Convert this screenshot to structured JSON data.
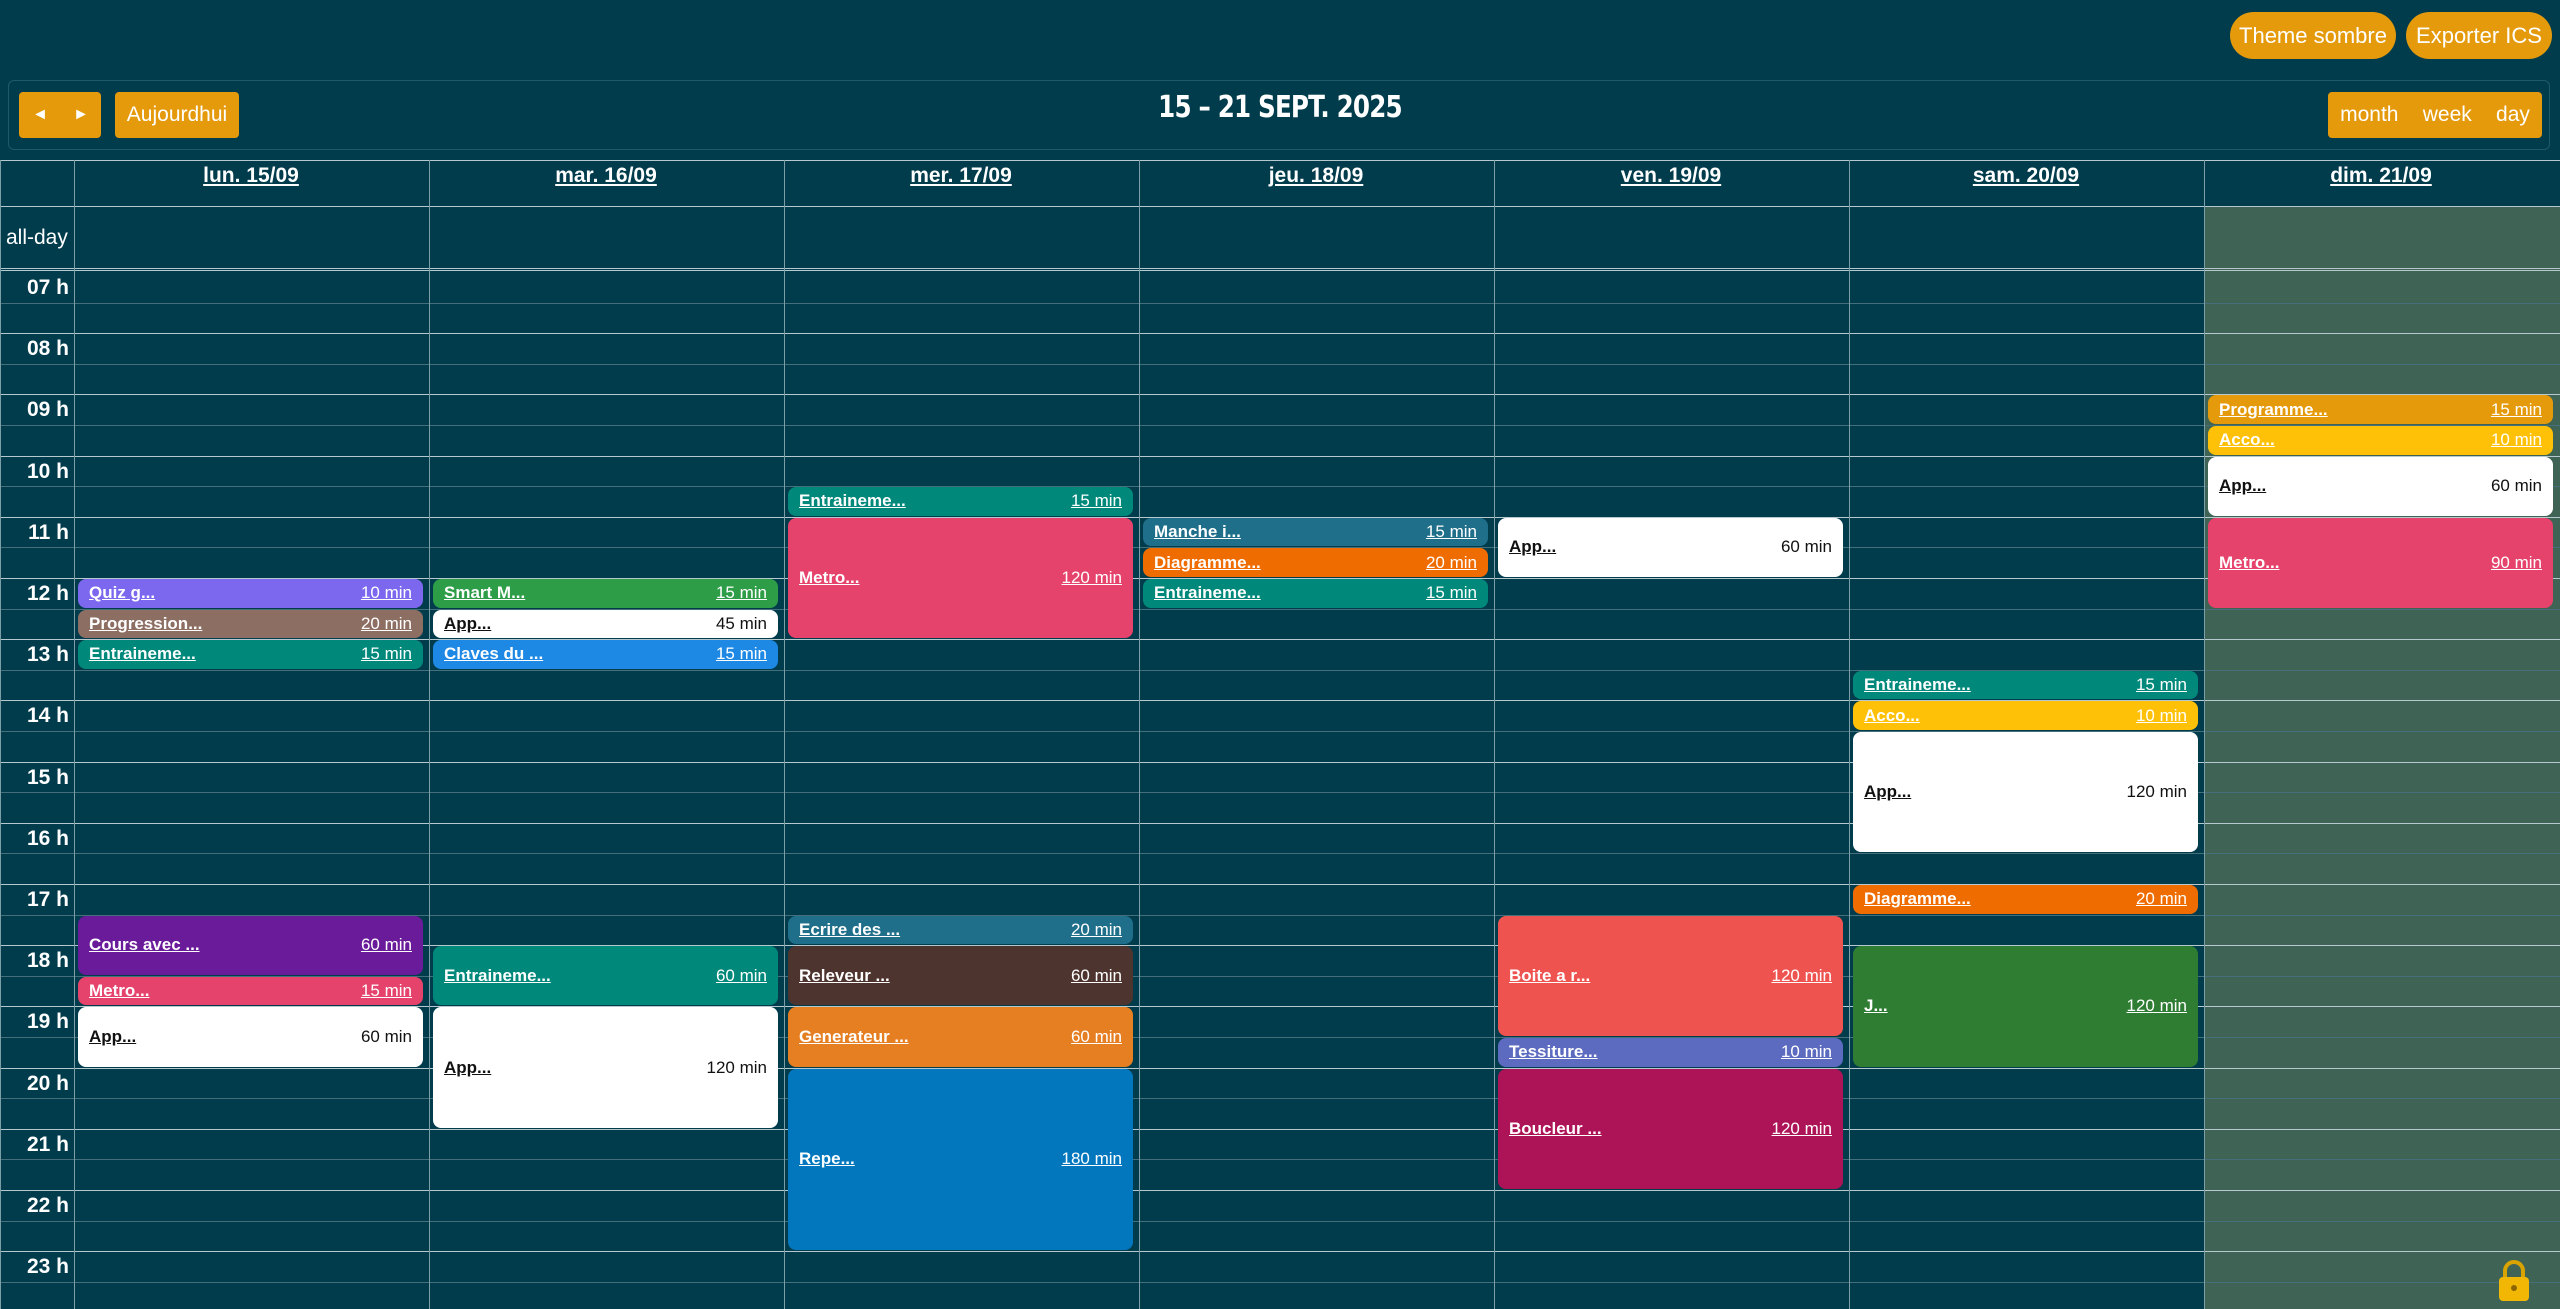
{
  "top_buttons": {
    "theme": "Theme sombre",
    "export": "Exporter ICS"
  },
  "toolbar": {
    "prev_icon": "◄",
    "next_icon": "►",
    "today": "Aujourdhui",
    "title": "15 – 21 SEPT. 2025",
    "views": [
      "month",
      "week",
      "day"
    ]
  },
  "days": [
    "lun. 15/09",
    "mar. 16/09",
    "mer. 17/09",
    "jeu. 18/09",
    "ven. 19/09",
    "sam. 20/09",
    "dim. 21/09"
  ],
  "allday_label": "all-day",
  "hours": [
    "07 h",
    "08 h",
    "09 h",
    "10 h",
    "11 h",
    "12 h",
    "13 h",
    "14 h",
    "15 h",
    "16 h",
    "17 h",
    "18 h",
    "19 h",
    "20 h",
    "21 h",
    "22 h",
    "23 h"
  ],
  "colors": {
    "background": "#003c4c",
    "accent": "#e59a0c",
    "sunday_highlight": "#3f6355"
  },
  "events": [
    {
      "day": 0,
      "start": "12:00",
      "minutes": 30,
      "title": "Quiz g...",
      "duration": "10 min",
      "color": "#7b68ee"
    },
    {
      "day": 0,
      "start": "12:30",
      "minutes": 30,
      "title": "Progression...",
      "duration": "20 min",
      "color": "#8d6e63"
    },
    {
      "day": 0,
      "start": "13:00",
      "minutes": 30,
      "title": "Entraineme...",
      "duration": "15 min",
      "color": "#00897b"
    },
    {
      "day": 0,
      "start": "17:30",
      "minutes": 60,
      "title": "Cours avec ...",
      "duration": "60 min",
      "color": "#6a1b9a"
    },
    {
      "day": 0,
      "start": "18:30",
      "minutes": 30,
      "title": "Metro...",
      "duration": "15 min",
      "color": "#e5436b"
    },
    {
      "day": 0,
      "start": "19:00",
      "minutes": 60,
      "title": "App...",
      "duration": "60 min",
      "color": "#ffffff"
    },
    {
      "day": 1,
      "start": "12:00",
      "minutes": 30,
      "title": "Smart M...",
      "duration": "15 min",
      "color": "#2e9d47"
    },
    {
      "day": 1,
      "start": "12:30",
      "minutes": 30,
      "title": "App...",
      "duration": "45 min",
      "color": "#ffffff"
    },
    {
      "day": 1,
      "start": "13:00",
      "minutes": 30,
      "title": "Claves du ...",
      "duration": "15 min",
      "color": "#1e88e5"
    },
    {
      "day": 1,
      "start": "18:00",
      "minutes": 60,
      "title": "Entraineme...",
      "duration": "60 min",
      "color": "#00897b"
    },
    {
      "day": 1,
      "start": "19:00",
      "minutes": 120,
      "title": "App...",
      "duration": "120 min",
      "color": "#ffffff"
    },
    {
      "day": 2,
      "start": "10:30",
      "minutes": 30,
      "title": "Entraineme...",
      "duration": "15 min",
      "color": "#00897b"
    },
    {
      "day": 2,
      "start": "11:00",
      "minutes": 120,
      "title": "Metro...",
      "duration": "120 min",
      "color": "#e5436b"
    },
    {
      "day": 2,
      "start": "17:30",
      "minutes": 30,
      "title": "Ecrire des ...",
      "duration": "20 min",
      "color": "#1f6f8b"
    },
    {
      "day": 2,
      "start": "18:00",
      "minutes": 60,
      "title": "Releveur ...",
      "duration": "60 min",
      "color": "#4e342e"
    },
    {
      "day": 2,
      "start": "19:00",
      "minutes": 60,
      "title": "Generateur ...",
      "duration": "60 min",
      "color": "#e67e22"
    },
    {
      "day": 2,
      "start": "20:00",
      "minutes": 180,
      "title": "Repe...",
      "duration": "180 min",
      "color": "#0277bd"
    },
    {
      "day": 3,
      "start": "11:00",
      "minutes": 30,
      "title": "Manche i...",
      "duration": "15 min",
      "color": "#1f6f8b"
    },
    {
      "day": 3,
      "start": "11:30",
      "minutes": 30,
      "title": "Diagramme...",
      "duration": "20 min",
      "color": "#ef6c00"
    },
    {
      "day": 3,
      "start": "12:00",
      "minutes": 30,
      "title": "Entraineme...",
      "duration": "15 min",
      "color": "#00897b"
    },
    {
      "day": 4,
      "start": "11:00",
      "minutes": 60,
      "title": "App...",
      "duration": "60 min",
      "color": "#ffffff"
    },
    {
      "day": 4,
      "start": "17:30",
      "minutes": 120,
      "title": "Boite a r...",
      "duration": "120 min",
      "color": "#ef5350"
    },
    {
      "day": 4,
      "start": "19:30",
      "minutes": 30,
      "title": "Tessiture...",
      "duration": "10 min",
      "color": "#5c6bc0"
    },
    {
      "day": 4,
      "start": "20:00",
      "minutes": 120,
      "title": "Boucleur ...",
      "duration": "120 min",
      "color": "#ad1457"
    },
    {
      "day": 5,
      "start": "13:30",
      "minutes": 30,
      "title": "Entraineme...",
      "duration": "15 min",
      "color": "#00897b"
    },
    {
      "day": 5,
      "start": "14:00",
      "minutes": 30,
      "title": "Acco...",
      "duration": "10 min",
      "color": "#ffc107"
    },
    {
      "day": 5,
      "start": "14:30",
      "minutes": 120,
      "title": "App...",
      "duration": "120 min",
      "color": "#ffffff"
    },
    {
      "day": 5,
      "start": "17:00",
      "minutes": 30,
      "title": "Diagramme...",
      "duration": "20 min",
      "color": "#ef6c00"
    },
    {
      "day": 5,
      "start": "18:00",
      "minutes": 120,
      "title": "J...",
      "duration": "120 min",
      "color": "#2e7d32"
    },
    {
      "day": 6,
      "start": "09:00",
      "minutes": 30,
      "title": "Programme...",
      "duration": "15 min",
      "color": "#e59a0c"
    },
    {
      "day": 6,
      "start": "09:30",
      "minutes": 30,
      "title": "Acco...",
      "duration": "10 min",
      "color": "#ffc107"
    },
    {
      "day": 6,
      "start": "10:00",
      "minutes": 60,
      "title": "App...",
      "duration": "60 min",
      "color": "#ffffff"
    },
    {
      "day": 6,
      "start": "11:00",
      "minutes": 90,
      "title": "Metro...",
      "duration": "90 min",
      "color": "#e5436b"
    }
  ]
}
